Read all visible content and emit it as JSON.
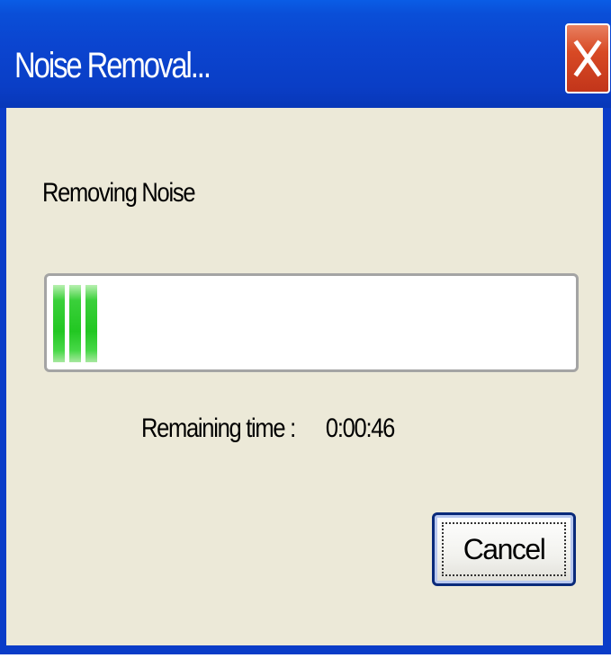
{
  "window": {
    "title": "Noise Removal...",
    "close_icon": "close-x-icon"
  },
  "dialog": {
    "status_label": "Removing Noise",
    "progress": {
      "segments_filled": 3,
      "fraction": 0.08,
      "color": "#22c722"
    },
    "remaining_time_label": "Remaining time :",
    "remaining_time_value": "0:00:46",
    "cancel_label": "Cancel"
  },
  "colors": {
    "titlebar": "#0a4fd8",
    "close_button": "#d84a25",
    "dialog_background": "#ece9d8"
  }
}
